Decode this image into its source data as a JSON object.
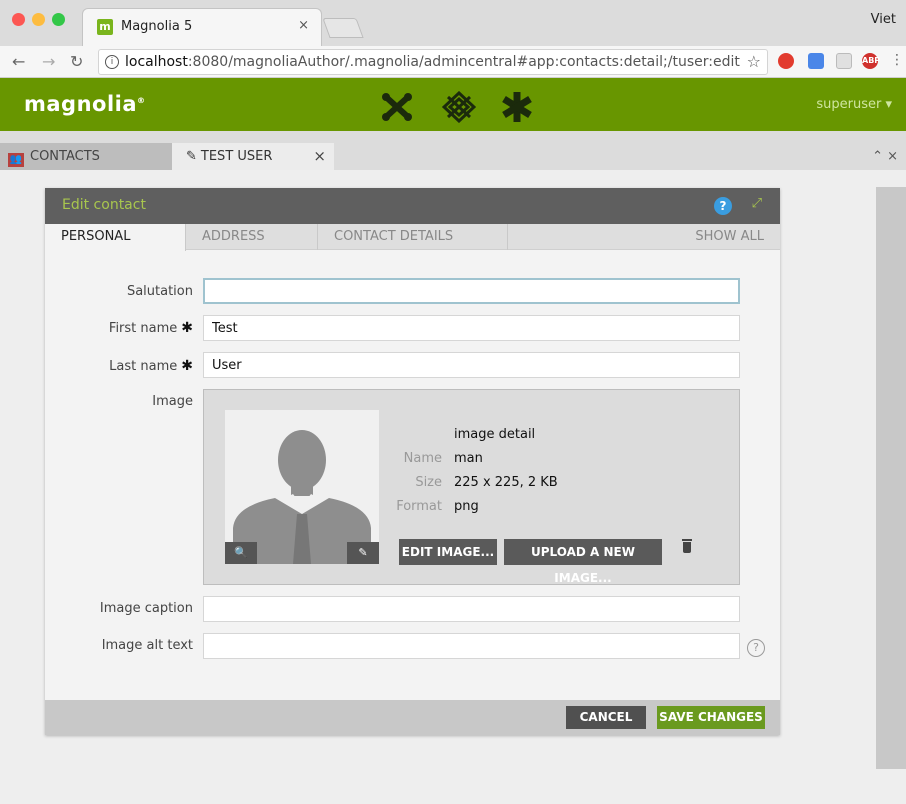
{
  "browser": {
    "tab_title": "Magnolia 5",
    "tab_favicon": "m",
    "tab_close": "×",
    "profile": "Viet",
    "url_host": "localhost",
    "url_rest": ":8080/magnoliaAuthor/.magnolia/admincentral#app:contacts:detail;/tuser:edit",
    "ext_abp": "ABP"
  },
  "header": {
    "logo": "magnolia",
    "logo_mark": "®",
    "user": "superuser ▾"
  },
  "app_tabs": {
    "contacts": "CONTACTS",
    "edit_user": "TEST USER",
    "close": "×",
    "right_controls": "⌃ ×"
  },
  "dialog": {
    "title": "Edit contact",
    "help": "?",
    "expand": "⤢",
    "tabs": [
      "PERSONAL",
      "ADDRESS",
      "CONTACT DETAILS"
    ],
    "show_all": "SHOW ALL",
    "fields": {
      "salutation_label": "Salutation",
      "salutation_value": "",
      "first_name_label": "First name",
      "first_name_value": "Test",
      "last_name_label": "Last name",
      "last_name_value": "User",
      "required_marker": "✱",
      "image_label": "Image",
      "caption_label": "Image caption",
      "caption_value": "",
      "alt_label": "Image alt text",
      "alt_value": ""
    },
    "image": {
      "heading": "image detail",
      "name_key": "Name",
      "name_value": "man",
      "size_key": "Size",
      "size_value": "225 x 225, 2 KB",
      "format_key": "Format",
      "format_value": "png",
      "zoom_glyph": "🔍",
      "edit_glyph": "✎",
      "edit_button": "EDIT IMAGE...",
      "upload_button": "UPLOAD A NEW IMAGE..."
    },
    "help_hint": "?",
    "cancel": "CANCEL",
    "save": "SAVE CHANGES"
  },
  "colors": {
    "brand_green": "#689600",
    "accent_green": "#a8c64e",
    "contacts_red": "#b7413e",
    "help_blue": "#3a9de0",
    "save_green": "#6a9a1f"
  }
}
